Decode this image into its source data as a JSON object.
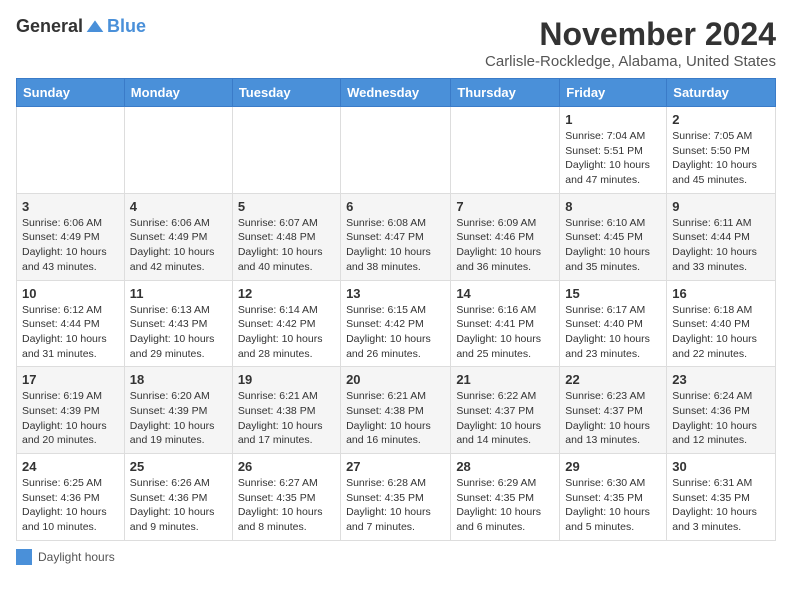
{
  "header": {
    "logo_general": "General",
    "logo_blue": "Blue",
    "month_title": "November 2024",
    "location": "Carlisle-Rockledge, Alabama, United States"
  },
  "days_of_week": [
    "Sunday",
    "Monday",
    "Tuesday",
    "Wednesday",
    "Thursday",
    "Friday",
    "Saturday"
  ],
  "weeks": [
    [
      {
        "day": "",
        "info": ""
      },
      {
        "day": "",
        "info": ""
      },
      {
        "day": "",
        "info": ""
      },
      {
        "day": "",
        "info": ""
      },
      {
        "day": "",
        "info": ""
      },
      {
        "day": "1",
        "info": "Sunrise: 7:04 AM\nSunset: 5:51 PM\nDaylight: 10 hours and 47 minutes."
      },
      {
        "day": "2",
        "info": "Sunrise: 7:05 AM\nSunset: 5:50 PM\nDaylight: 10 hours and 45 minutes."
      }
    ],
    [
      {
        "day": "3",
        "info": "Sunrise: 6:06 AM\nSunset: 4:49 PM\nDaylight: 10 hours and 43 minutes."
      },
      {
        "day": "4",
        "info": "Sunrise: 6:06 AM\nSunset: 4:49 PM\nDaylight: 10 hours and 42 minutes."
      },
      {
        "day": "5",
        "info": "Sunrise: 6:07 AM\nSunset: 4:48 PM\nDaylight: 10 hours and 40 minutes."
      },
      {
        "day": "6",
        "info": "Sunrise: 6:08 AM\nSunset: 4:47 PM\nDaylight: 10 hours and 38 minutes."
      },
      {
        "day": "7",
        "info": "Sunrise: 6:09 AM\nSunset: 4:46 PM\nDaylight: 10 hours and 36 minutes."
      },
      {
        "day": "8",
        "info": "Sunrise: 6:10 AM\nSunset: 4:45 PM\nDaylight: 10 hours and 35 minutes."
      },
      {
        "day": "9",
        "info": "Sunrise: 6:11 AM\nSunset: 4:44 PM\nDaylight: 10 hours and 33 minutes."
      }
    ],
    [
      {
        "day": "10",
        "info": "Sunrise: 6:12 AM\nSunset: 4:44 PM\nDaylight: 10 hours and 31 minutes."
      },
      {
        "day": "11",
        "info": "Sunrise: 6:13 AM\nSunset: 4:43 PM\nDaylight: 10 hours and 29 minutes."
      },
      {
        "day": "12",
        "info": "Sunrise: 6:14 AM\nSunset: 4:42 PM\nDaylight: 10 hours and 28 minutes."
      },
      {
        "day": "13",
        "info": "Sunrise: 6:15 AM\nSunset: 4:42 PM\nDaylight: 10 hours and 26 minutes."
      },
      {
        "day": "14",
        "info": "Sunrise: 6:16 AM\nSunset: 4:41 PM\nDaylight: 10 hours and 25 minutes."
      },
      {
        "day": "15",
        "info": "Sunrise: 6:17 AM\nSunset: 4:40 PM\nDaylight: 10 hours and 23 minutes."
      },
      {
        "day": "16",
        "info": "Sunrise: 6:18 AM\nSunset: 4:40 PM\nDaylight: 10 hours and 22 minutes."
      }
    ],
    [
      {
        "day": "17",
        "info": "Sunrise: 6:19 AM\nSunset: 4:39 PM\nDaylight: 10 hours and 20 minutes."
      },
      {
        "day": "18",
        "info": "Sunrise: 6:20 AM\nSunset: 4:39 PM\nDaylight: 10 hours and 19 minutes."
      },
      {
        "day": "19",
        "info": "Sunrise: 6:21 AM\nSunset: 4:38 PM\nDaylight: 10 hours and 17 minutes."
      },
      {
        "day": "20",
        "info": "Sunrise: 6:21 AM\nSunset: 4:38 PM\nDaylight: 10 hours and 16 minutes."
      },
      {
        "day": "21",
        "info": "Sunrise: 6:22 AM\nSunset: 4:37 PM\nDaylight: 10 hours and 14 minutes."
      },
      {
        "day": "22",
        "info": "Sunrise: 6:23 AM\nSunset: 4:37 PM\nDaylight: 10 hours and 13 minutes."
      },
      {
        "day": "23",
        "info": "Sunrise: 6:24 AM\nSunset: 4:36 PM\nDaylight: 10 hours and 12 minutes."
      }
    ],
    [
      {
        "day": "24",
        "info": "Sunrise: 6:25 AM\nSunset: 4:36 PM\nDaylight: 10 hours and 10 minutes."
      },
      {
        "day": "25",
        "info": "Sunrise: 6:26 AM\nSunset: 4:36 PM\nDaylight: 10 hours and 9 minutes."
      },
      {
        "day": "26",
        "info": "Sunrise: 6:27 AM\nSunset: 4:35 PM\nDaylight: 10 hours and 8 minutes."
      },
      {
        "day": "27",
        "info": "Sunrise: 6:28 AM\nSunset: 4:35 PM\nDaylight: 10 hours and 7 minutes."
      },
      {
        "day": "28",
        "info": "Sunrise: 6:29 AM\nSunset: 4:35 PM\nDaylight: 10 hours and 6 minutes."
      },
      {
        "day": "29",
        "info": "Sunrise: 6:30 AM\nSunset: 4:35 PM\nDaylight: 10 hours and 5 minutes."
      },
      {
        "day": "30",
        "info": "Sunrise: 6:31 AM\nSunset: 4:35 PM\nDaylight: 10 hours and 3 minutes."
      }
    ]
  ],
  "legend": {
    "label": "Daylight hours"
  }
}
